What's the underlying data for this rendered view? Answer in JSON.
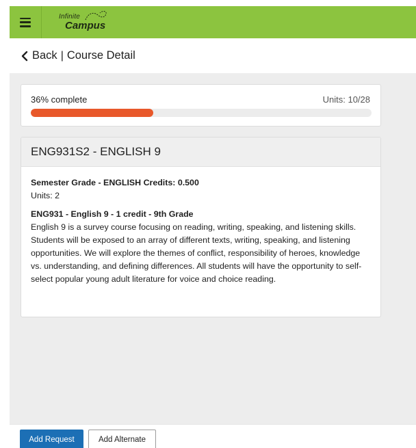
{
  "app": {
    "logo_top": "Infinite",
    "logo_bottom": "Campus",
    "brand_color": "#8cc43f"
  },
  "header": {
    "back_label": "Back",
    "separator": "|",
    "title": "Course Detail"
  },
  "progress": {
    "label": "36% complete",
    "percent": 36,
    "units_text": "Units: 10/28",
    "fill_color": "#e8582a"
  },
  "course": {
    "title": "ENG931S2 - ENGLISH 9",
    "grade_line": "Semester Grade - ENGLISH Credits: 0.500",
    "units_line": "Units: 2",
    "desc_heading": "ENG931 - English 9 - 1 credit - 9th Grade",
    "description": "English 9 is a survey course focusing on reading, writing, speaking, and listening skills.  Students will be exposed to an array of different texts, writing, speaking, and listening opportunities.  We will explore the themes of conflict, responsibility of heroes, knowledge vs. understanding, and defining differences.  All students will have the opportunity to self-select popular young adult literature for voice and choice reading."
  },
  "footer": {
    "add_request": "Add Request",
    "add_alternate": "Add Alternate"
  },
  "icons": {
    "menu": "hamburger-menu-icon",
    "back": "chevron-left-icon"
  }
}
